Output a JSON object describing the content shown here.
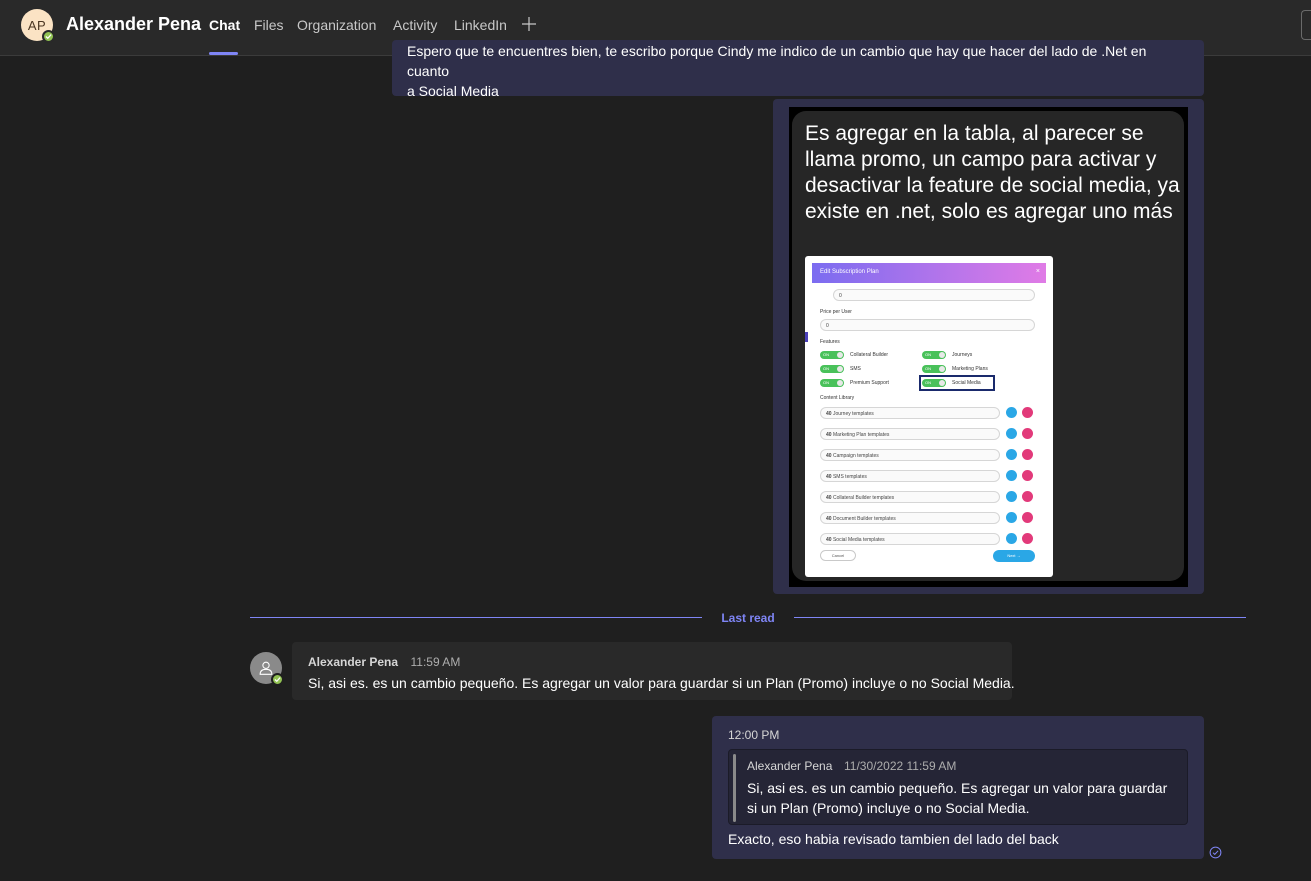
{
  "header": {
    "avatar_initials": "AP",
    "contact_name": "Alexander Pena",
    "tabs": [
      "Chat",
      "Files",
      "Organization",
      "Activity",
      "LinkedIn"
    ],
    "add_tab_icon": "plus-icon"
  },
  "messages": {
    "top": {
      "line1": "Espero que te encuentres bien, te escribo porque Cindy me indico de un cambio que hay que hacer del lado de .Net en cuanto",
      "line2": "a Social Media"
    },
    "image": {
      "caption": "Es agregar en la tabla, al parecer se llama promo, un campo para activar y desactivar la feature de social media, ya existe en .net, solo es agregar uno más",
      "dialog": {
        "title": "Edit Subscription Plan",
        "close": "×",
        "price_label": "Price per User",
        "price_value": "0",
        "top_value": "0",
        "features_label": "Features",
        "toggle_text": "ON",
        "features_left": [
          "Collateral Builder",
          "SMS",
          "Premium Support"
        ],
        "features_right": [
          "Journeys",
          "Marketing Plans",
          "Social Media"
        ],
        "library_label": "Content Library",
        "library_items": [
          {
            "count": "40",
            "name": "Journey templates"
          },
          {
            "count": "40",
            "name": "Marketing Plan templates"
          },
          {
            "count": "40",
            "name": "Campaign templates"
          },
          {
            "count": "40",
            "name": "SMS templates"
          },
          {
            "count": "40",
            "name": "Collateral Builder templates"
          },
          {
            "count": "40",
            "name": "Document Builder templates"
          },
          {
            "count": "40",
            "name": "Social Media templates"
          }
        ],
        "cancel": "Cancel",
        "next": "Next"
      }
    },
    "divider_label": "Last read",
    "incoming": {
      "sender": "Alexander Pena",
      "time": "11:59 AM",
      "body": "Si, asi es. es un cambio pequeño. Es agregar un valor para guardar si un Plan (Promo) incluye o no Social Media."
    },
    "outgoing": {
      "time": "12:00 PM",
      "quote_sender": "Alexander Pena",
      "quote_time": "11/30/2022 11:59 AM",
      "quote_body": "Si, asi es. es un cambio pequeño. Es agregar un valor para guardar si un Plan (Promo) incluye o no Social Media.",
      "body": "Exacto, eso habia revisado tambien del lado del back"
    }
  },
  "colors": {
    "accent": "#7f85f5",
    "own_bubble": "#2f2f4a",
    "other_bubble": "#292929",
    "presence_available": "#92c353"
  }
}
